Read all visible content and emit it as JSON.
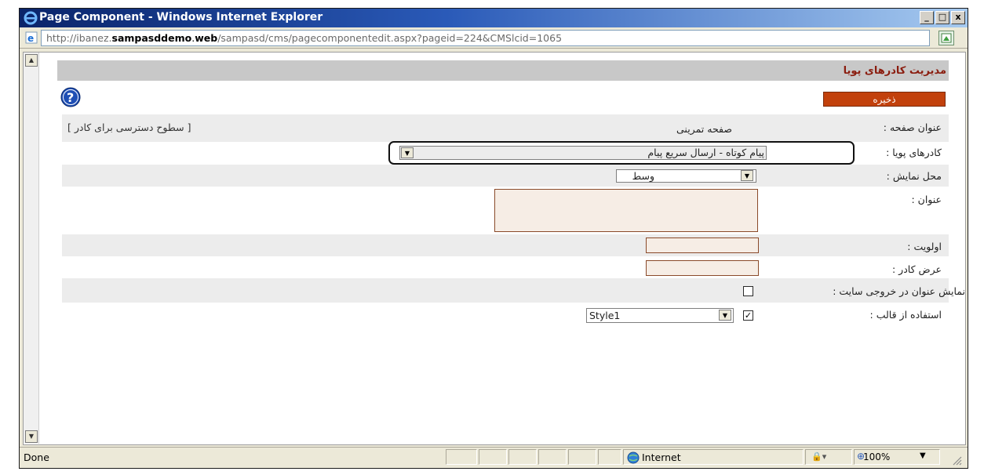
{
  "window": {
    "title": "Page Component - Windows Internet Explorer",
    "minimize": "_",
    "maximize": "□",
    "close": "x"
  },
  "address": {
    "prefix": "http://ibanez.",
    "bold": "sampasddemo",
    "dot": ".",
    "domain": "web",
    "path": "/sampasd/cms/pagecomponentedit.aspx?pageid=224&CMSlcid=1065"
  },
  "page": {
    "header_title": "مدیریت کادرهای پویا",
    "save_label": "ذخیره",
    "access_levels_link": "[ سطوح دسترسی برای کادر ]",
    "fields": {
      "page_title_label": "عنوان صفحه :",
      "page_title_value": "صفحه تمرینی",
      "dynamic_boxes_label": "کادرهای پویا :",
      "dynamic_boxes_value": "پیام کوتاه - ارسال سریع پیام",
      "display_location_label": "محل نمایش :",
      "display_location_value": "وسط",
      "title_label": "عنوان :",
      "title_value": "",
      "priority_label": "اولویت :",
      "priority_value": "",
      "box_width_label": "عرض کادر :",
      "box_width_value": "",
      "show_title_label": "نمایش عنوان در خروجی سایت :",
      "show_title_checked": false,
      "use_template_label": "استفاده از قالب :",
      "use_template_checked": true,
      "template_value": "Style1"
    }
  },
  "status": {
    "text": "Done",
    "zone": "Internet",
    "zoom": "100%"
  }
}
